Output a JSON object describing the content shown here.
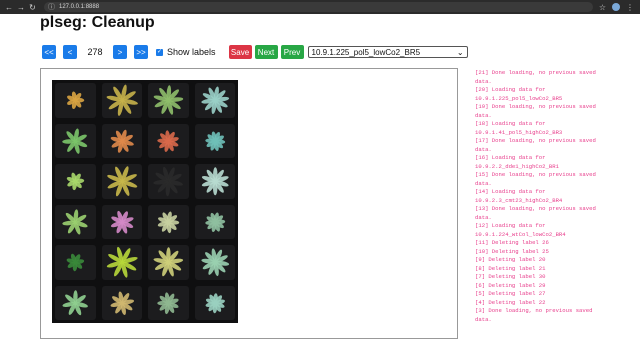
{
  "browser": {
    "url": "127.0.0.1:8888"
  },
  "page": {
    "title": "plseg: Cleanup"
  },
  "toolbar": {
    "first_label": "<<",
    "prev_page_label": "<",
    "page_number": "278",
    "next_page_label": ">",
    "last_label": ">>",
    "show_labels_text": "Show labels",
    "show_labels_checked": true,
    "save_label": "Save",
    "next_label": "Next",
    "prev_label": "Prev",
    "dataset_selected": "10.9.1.225_pol5_lowCo2_BR5"
  },
  "colors": {
    "primary": "#1a7be9",
    "danger": "#dc3545",
    "success": "#28a745",
    "log_text": "#e83e8c"
  },
  "log": [
    "[21] Done loading, no previous saved",
    "data.",
    "[20] Loading data for",
    "10.9.1.225_pol5_lowCo2_BR5",
    "[19] Done loading, no previous saved",
    "data.",
    "[18] Loading data for",
    "10.9.1.41_pol5_highCo2_BR3",
    "[17] Done loading, no previous saved",
    "data.",
    "[16] Loading data for",
    "10.9.2.2_dde1_highCo2_BR1",
    "[15] Done loading, no previous saved",
    "data.",
    "[14] Loading data for",
    "10.9.2.3_cmt23_highCo2_BR4",
    "[13] Done loading, no previous saved",
    "data.",
    "[12] Loading data for",
    "10.9.1.224_wtCol_lowCo2_BR4",
    "[11] Deleting label 26",
    "[10] Deleting label 25",
    "[9] Deleting label 20",
    "[8] Deleting label 21",
    "[7] Deleting label 30",
    "[6] Deleting label 29",
    "[5] Deleting label 27",
    "[4] Deleting label 22",
    "[3] Done loading, no previous saved",
    "data."
  ],
  "plants": [
    {
      "color": "#d9a441"
    },
    {
      "color": "#c8b24a"
    },
    {
      "color": "#8fbf6a"
    },
    {
      "color": "#9ad0c8"
    },
    {
      "color": "#7cc66a"
    },
    {
      "color": "#e08a4a"
    },
    {
      "color": "#d9694a"
    },
    {
      "color": "#6fc0b8"
    },
    {
      "color": "#a8d86a"
    },
    {
      "color": "#c9b84a"
    },
    {
      "color": "#2a2a2a"
    },
    {
      "color": "#b8dcd0"
    },
    {
      "color": "#9bd070"
    },
    {
      "color": "#d58ac8"
    },
    {
      "color": "#c8d0a0"
    },
    {
      "color": "#8fc0a0"
    },
    {
      "color": "#3a8a3a"
    },
    {
      "color": "#b8d83a"
    },
    {
      "color": "#cfd07a"
    },
    {
      "color": "#9ad0b0"
    },
    {
      "color": "#90d090"
    },
    {
      "color": "#d0b870"
    },
    {
      "color": "#8fb890"
    },
    {
      "color": "#9ad0c0"
    }
  ]
}
